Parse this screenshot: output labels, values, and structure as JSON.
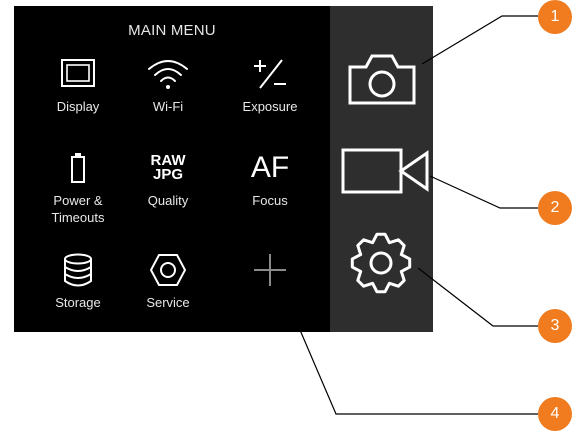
{
  "menu": {
    "title": "MAIN MENU",
    "items": [
      {
        "label": "Display",
        "icon": "display-icon"
      },
      {
        "label": "Wi-Fi",
        "icon": "wifi-icon"
      },
      {
        "label": "Exposure",
        "icon": "exposure-compensation-icon"
      },
      {
        "label": "Power & Timeouts",
        "icon": "battery-icon"
      },
      {
        "label": "Quality",
        "icon": "raw-jpg-icon",
        "icon_text_top": "RAW",
        "icon_text_bottom": "JPG"
      },
      {
        "label": "Focus",
        "icon": "autofocus-icon",
        "icon_text": "AF"
      },
      {
        "label": "Storage",
        "icon": "storage-icon"
      },
      {
        "label": "Service",
        "icon": "service-nut-icon"
      },
      {
        "label": "",
        "icon": "add-icon"
      }
    ]
  },
  "side_panel": {
    "items": [
      {
        "icon": "camera-icon"
      },
      {
        "icon": "video-camera-icon"
      },
      {
        "icon": "settings-gear-icon"
      }
    ]
  },
  "callouts": [
    "1",
    "2",
    "3",
    "4"
  ],
  "colors": {
    "menu_background": "#000000",
    "side_panel_background": "#2e2e2e",
    "badge": "#f07c1f",
    "icon": "#ffffff",
    "add_icon": "#8a8a8a"
  }
}
